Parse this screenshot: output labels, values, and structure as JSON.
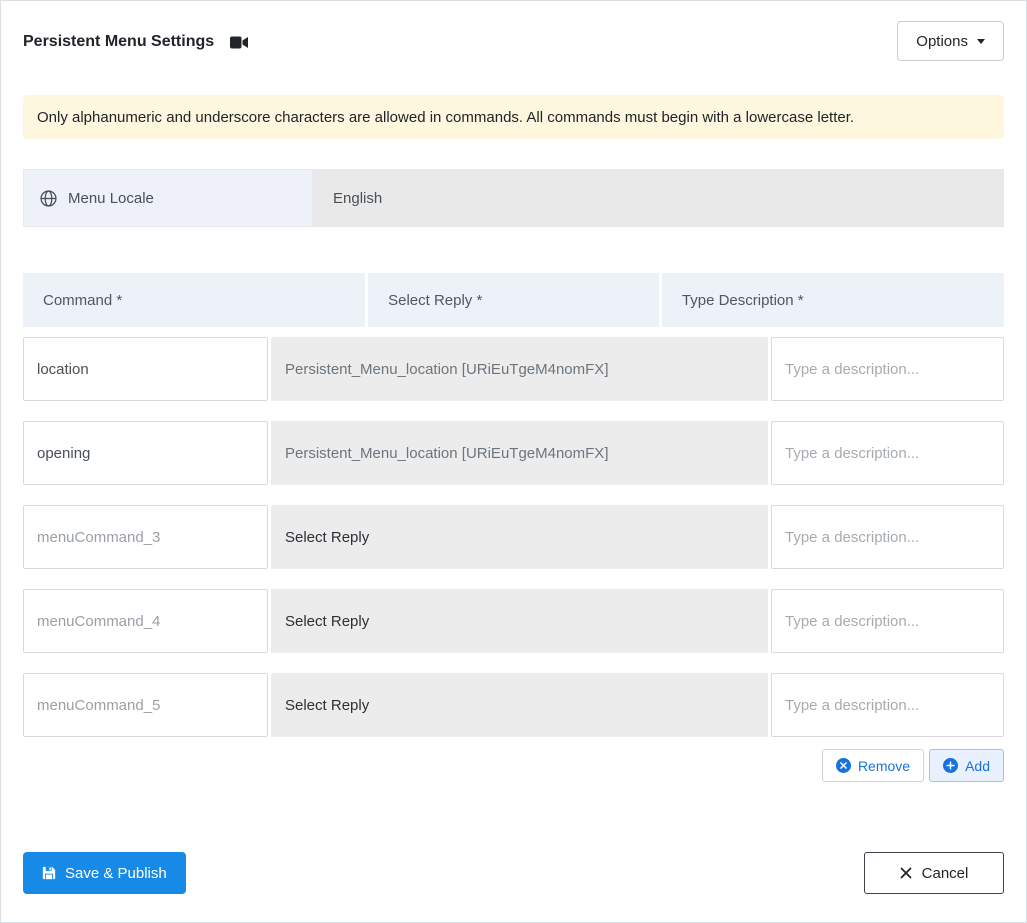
{
  "header": {
    "title": "Persistent Menu Settings",
    "options_button": "Options"
  },
  "alert": {
    "message": "Only alphanumeric and underscore characters are allowed in commands. All commands must begin with a lowercase letter."
  },
  "locale": {
    "label": "Menu Locale",
    "value": "English"
  },
  "table": {
    "headers": {
      "command": "Command *",
      "reply": "Select Reply *",
      "description": "Type Description *"
    },
    "rows": [
      {
        "command": "location",
        "reply": "Persistent_Menu_location [URiEuTgeM4nomFX]",
        "reply_is_set": true,
        "description_placeholder": "Type a description..."
      },
      {
        "command": "opening",
        "reply": "Persistent_Menu_location [URiEuTgeM4nomFX]",
        "reply_is_set": true,
        "description_placeholder": "Type a description..."
      },
      {
        "command_placeholder": "menuCommand_3",
        "reply": "Select Reply",
        "reply_is_set": false,
        "description_placeholder": "Type a description..."
      },
      {
        "command_placeholder": "menuCommand_4",
        "reply": "Select Reply",
        "reply_is_set": false,
        "description_placeholder": "Type a description..."
      },
      {
        "command_placeholder": "menuCommand_5",
        "reply": "Select Reply",
        "reply_is_set": false,
        "description_placeholder": "Type a description..."
      }
    ]
  },
  "row_actions": {
    "remove": "Remove",
    "add": "Add"
  },
  "footer": {
    "save": "Save & Publish",
    "cancel": "Cancel"
  },
  "icons": {
    "title": "video-camera-icon",
    "locale": "globe-icon",
    "options": "caret-down-icon",
    "remove": "x-circle-icon",
    "add": "plus-circle-icon",
    "save": "floppy-disk-icon",
    "cancel": "x-icon"
  },
  "colors": {
    "primary_blue": "#1789e6",
    "action_blue": "#1673dd",
    "alert_bg": "#fdf7df",
    "table_header_bg": "#edf2f8",
    "reply_cell_bg": "#ececec",
    "locale_label_bg": "#eef2f8",
    "locale_value_bg": "#e9e9e9"
  }
}
